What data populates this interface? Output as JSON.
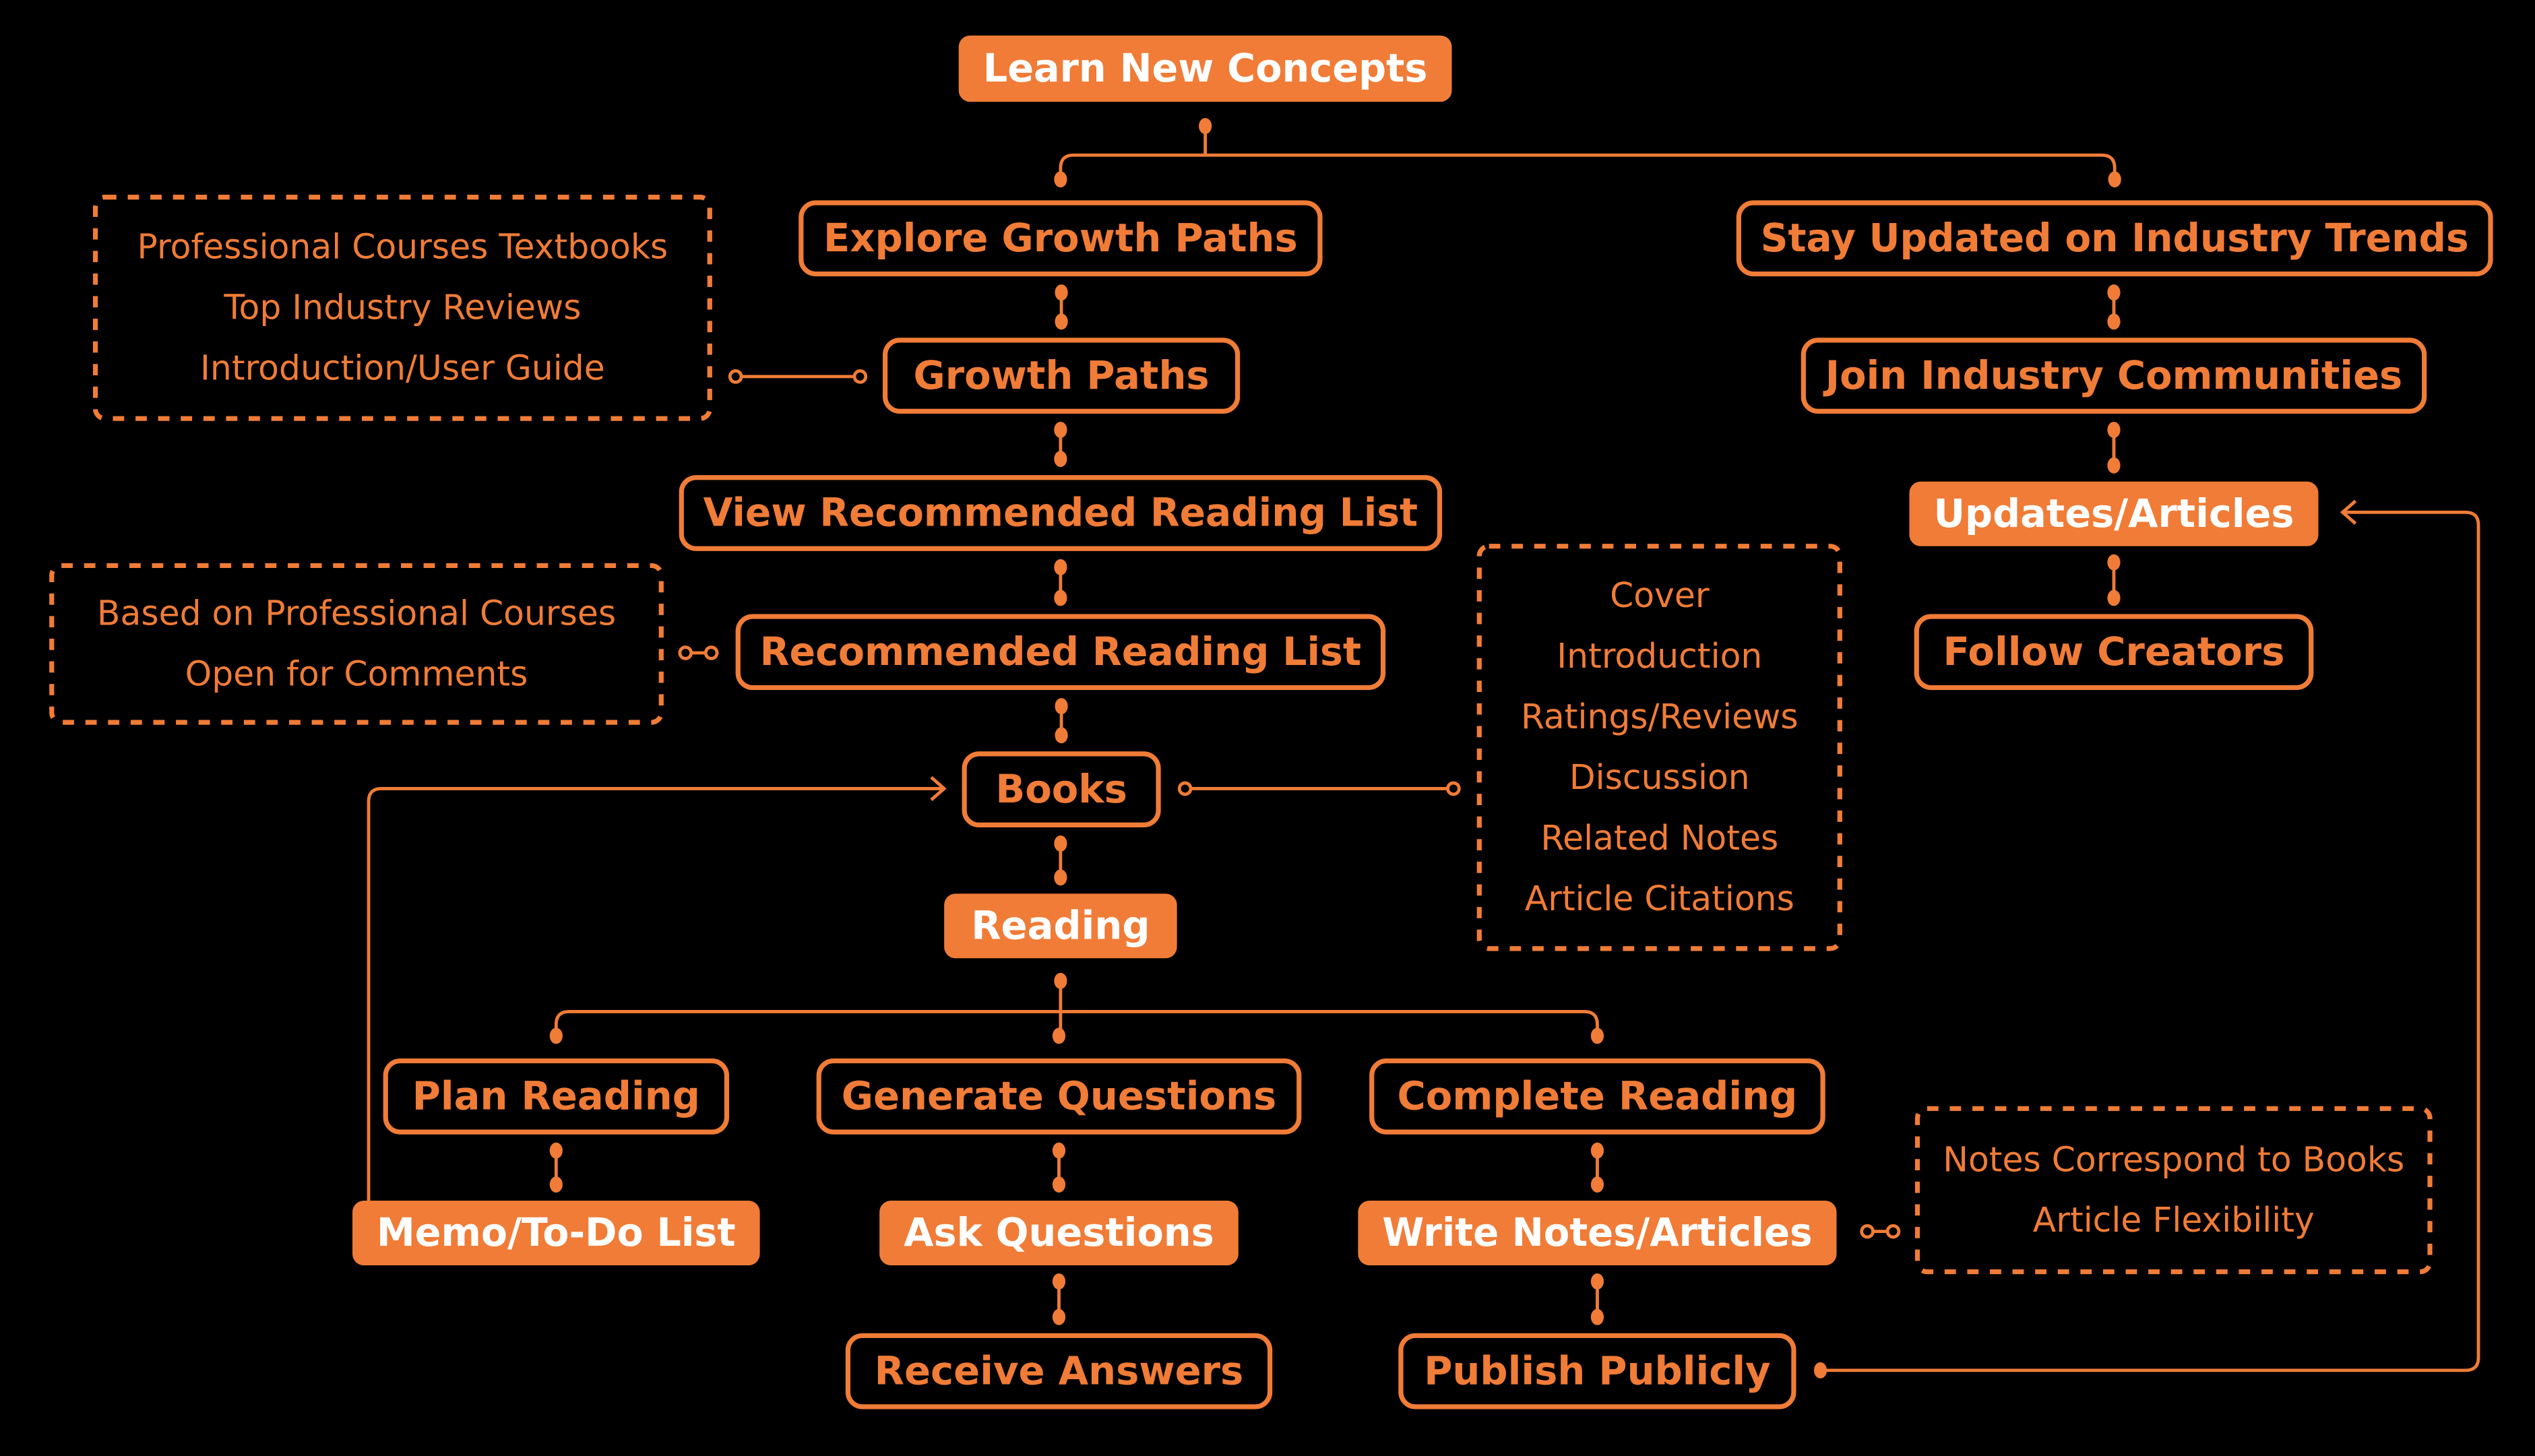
{
  "diagram": {
    "accent_color": "#F07C37",
    "background_color": "#000000",
    "filled_text_color": "#FFFFFF",
    "nodes": [
      {
        "id": "learn",
        "label": "Learn New Concepts",
        "style": "filled"
      },
      {
        "id": "explore",
        "label": "Explore Growth Paths",
        "style": "outline"
      },
      {
        "id": "stay",
        "label": "Stay Updated on Industry Trends",
        "style": "outline"
      },
      {
        "id": "growth",
        "label": "Growth Paths",
        "style": "outline"
      },
      {
        "id": "join",
        "label": "Join Industry Communities",
        "style": "outline"
      },
      {
        "id": "viewlist",
        "label": "View Recommended Reading List",
        "style": "outline"
      },
      {
        "id": "updates",
        "label": "Updates/Articles",
        "style": "filled"
      },
      {
        "id": "reclist",
        "label": "Recommended Reading List",
        "style": "outline"
      },
      {
        "id": "follow",
        "label": "Follow Creators",
        "style": "outline"
      },
      {
        "id": "books",
        "label": "Books",
        "style": "outline"
      },
      {
        "id": "reading",
        "label": "Reading",
        "style": "filled"
      },
      {
        "id": "plan",
        "label": "Plan Reading",
        "style": "outline"
      },
      {
        "id": "genq",
        "label": "Generate Questions",
        "style": "outline"
      },
      {
        "id": "complete",
        "label": "Complete Reading",
        "style": "outline"
      },
      {
        "id": "memo",
        "label": "Memo/To-Do List",
        "style": "filled"
      },
      {
        "id": "ask",
        "label": "Ask Questions",
        "style": "filled"
      },
      {
        "id": "write",
        "label": "Write Notes/Articles",
        "style": "filled"
      },
      {
        "id": "receive",
        "label": "Receive Answers",
        "style": "outline"
      },
      {
        "id": "publish",
        "label": "Publish Publicly",
        "style": "outline"
      }
    ],
    "notes": [
      {
        "id": "growth-notes",
        "attached_to": "growth",
        "lines": [
          "Professional Courses Textbooks",
          "Top Industry Reviews",
          "Introduction/User Guide"
        ]
      },
      {
        "id": "reclist-notes",
        "attached_to": "reclist",
        "lines": [
          "Based on Professional Courses",
          "Open for Comments"
        ]
      },
      {
        "id": "books-notes",
        "attached_to": "books",
        "lines": [
          "Cover",
          "Introduction",
          "Ratings/Reviews",
          "Discussion",
          "Related Notes",
          "Article Citations"
        ]
      },
      {
        "id": "write-notes",
        "attached_to": "write",
        "lines": [
          "Notes Correspond to Books",
          "Article Flexibility"
        ]
      }
    ],
    "edges": [
      {
        "from": "learn",
        "to": "explore",
        "type": "branch"
      },
      {
        "from": "learn",
        "to": "stay",
        "type": "branch"
      },
      {
        "from": "explore",
        "to": "growth",
        "type": "link"
      },
      {
        "from": "growth",
        "to": "viewlist",
        "type": "link"
      },
      {
        "from": "viewlist",
        "to": "reclist",
        "type": "link"
      },
      {
        "from": "reclist",
        "to": "books",
        "type": "link"
      },
      {
        "from": "books",
        "to": "reading",
        "type": "link"
      },
      {
        "from": "reading",
        "to": "plan",
        "type": "branch"
      },
      {
        "from": "reading",
        "to": "genq",
        "type": "branch"
      },
      {
        "from": "reading",
        "to": "complete",
        "type": "branch"
      },
      {
        "from": "plan",
        "to": "memo",
        "type": "link"
      },
      {
        "from": "genq",
        "to": "ask",
        "type": "link"
      },
      {
        "from": "ask",
        "to": "receive",
        "type": "link"
      },
      {
        "from": "complete",
        "to": "write",
        "type": "link"
      },
      {
        "from": "write",
        "to": "publish",
        "type": "link"
      },
      {
        "from": "stay",
        "to": "join",
        "type": "link"
      },
      {
        "from": "join",
        "to": "updates",
        "type": "link"
      },
      {
        "from": "updates",
        "to": "follow",
        "type": "link"
      },
      {
        "from": "memo",
        "to": "books",
        "type": "arrow"
      },
      {
        "from": "publish",
        "to": "updates",
        "type": "arrow"
      }
    ]
  }
}
